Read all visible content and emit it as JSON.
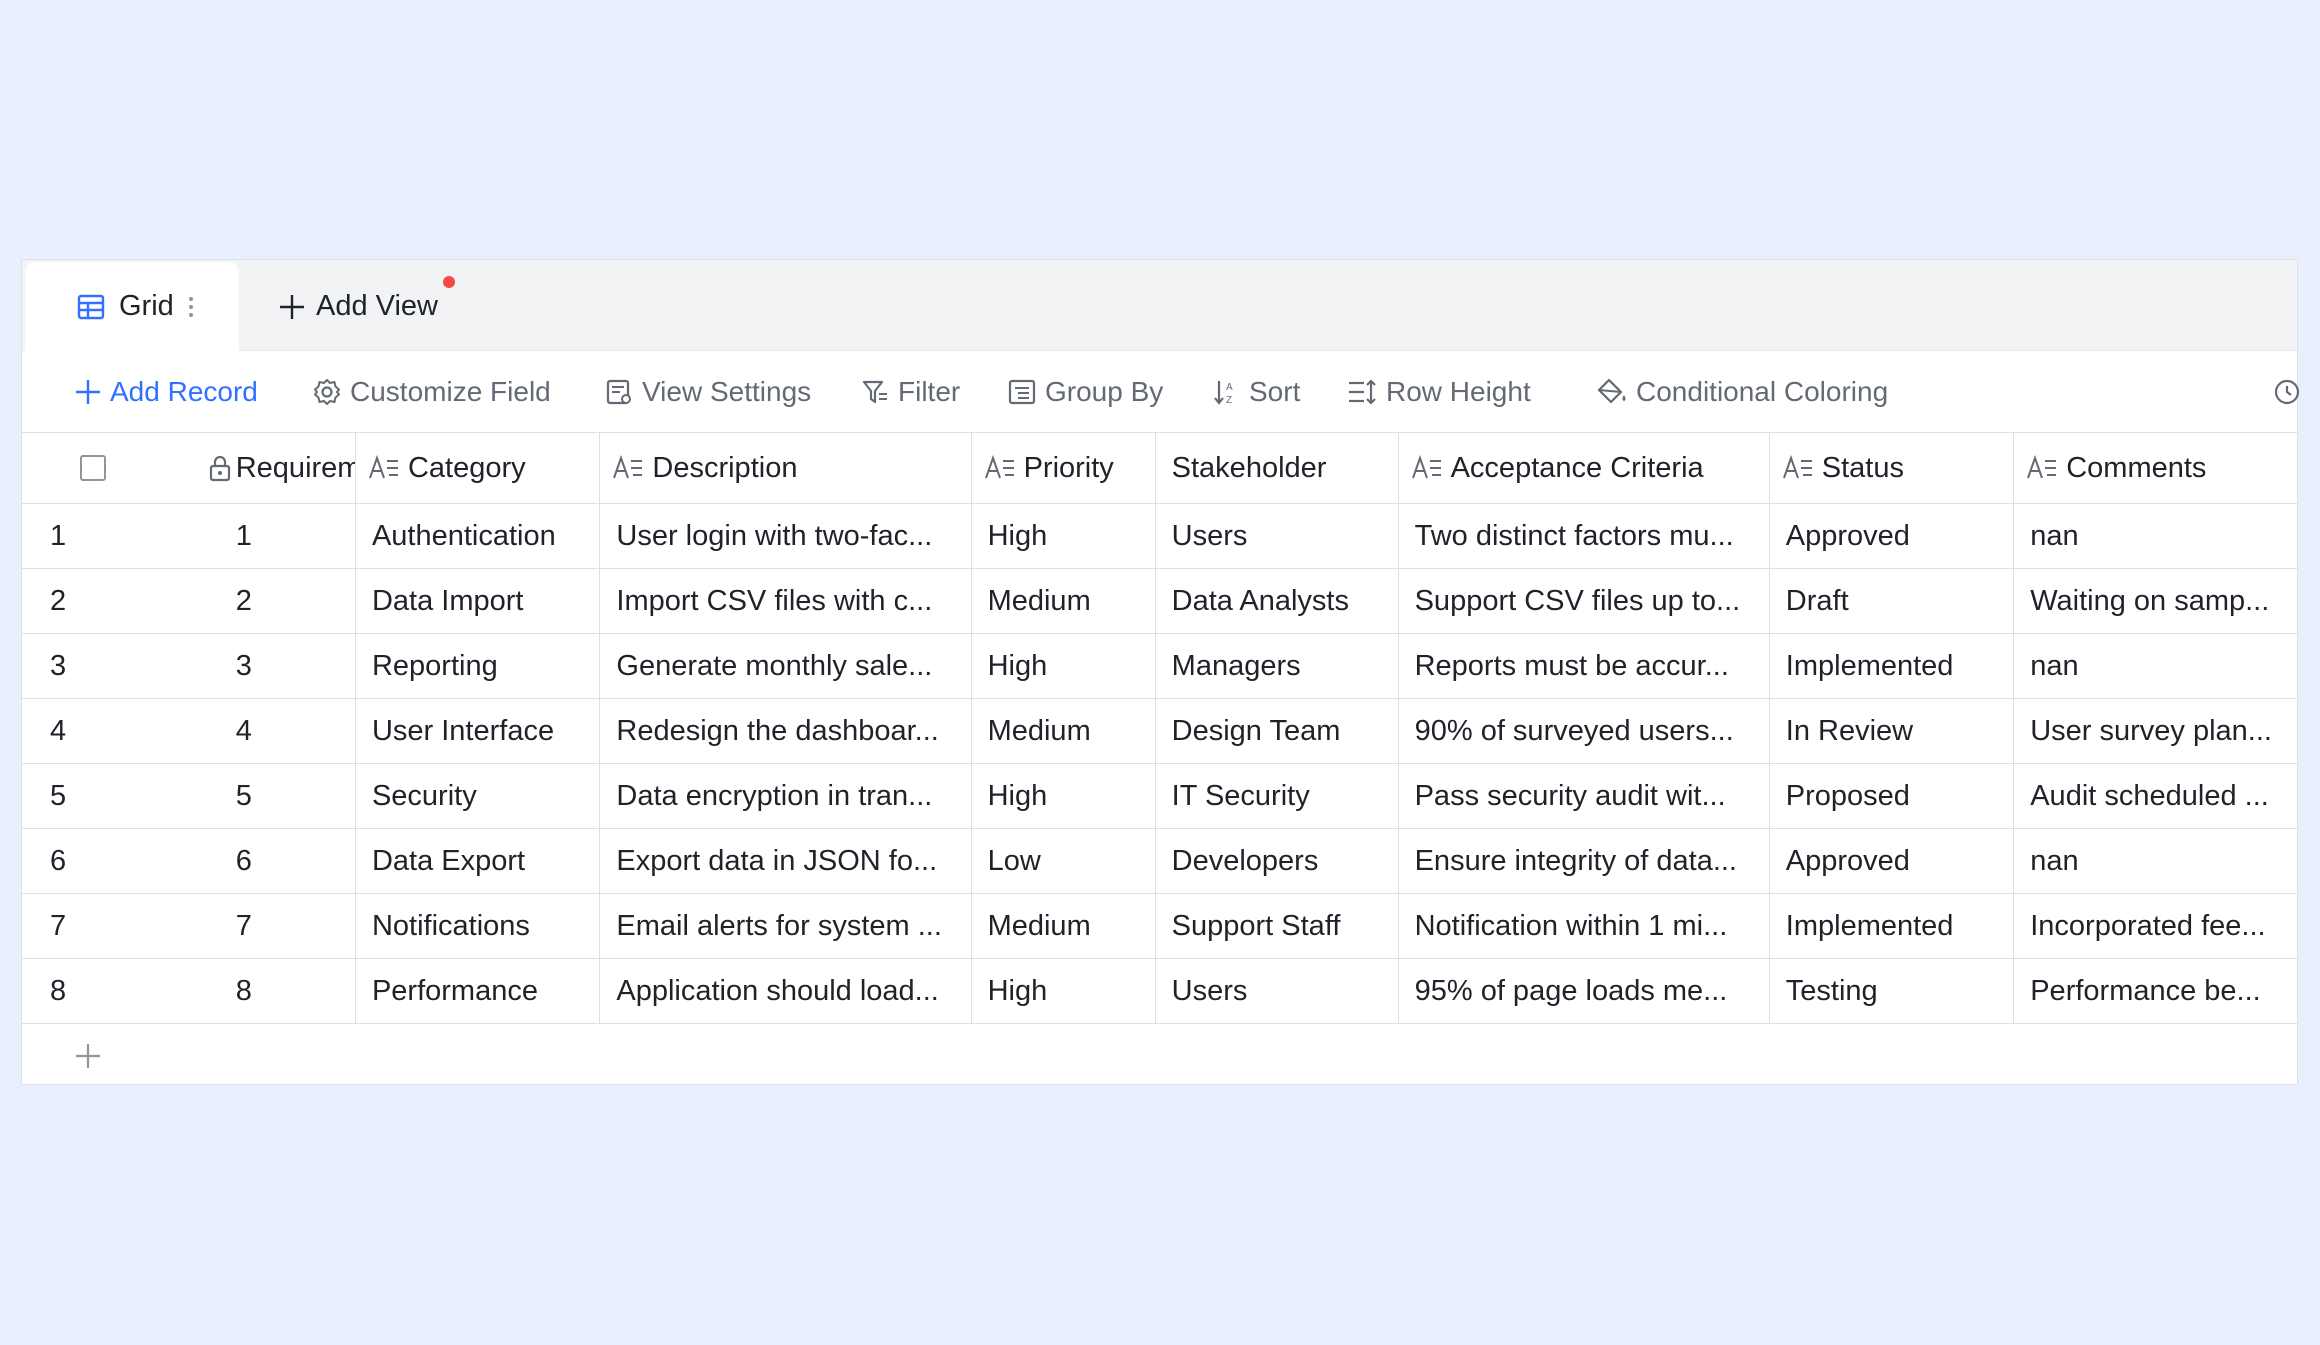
{
  "tabs": {
    "grid_label": "Grid",
    "add_view_label": "Add View"
  },
  "toolbar": {
    "add_record": "Add Record",
    "customize_field": "Customize Field",
    "view_settings": "View Settings",
    "filter": "Filter",
    "group_by": "Group By",
    "sort": "Sort",
    "row_height": "Row Height",
    "conditional_coloring": "Conditional Coloring"
  },
  "columns": {
    "requirement": "Requireme...",
    "category": "Category",
    "description": "Description",
    "priority": "Priority",
    "stakeholder": "Stakeholder",
    "acceptance": "Acceptance Criteria",
    "status": "Status",
    "comments": "Comments"
  },
  "rows": [
    {
      "idx": "1",
      "req": "1",
      "category": "Authentication",
      "description": "User login with two-fac...",
      "priority": "High",
      "stakeholder": "Users",
      "acceptance": "Two distinct factors mu...",
      "status": "Approved",
      "comments": "nan"
    },
    {
      "idx": "2",
      "req": "2",
      "category": "Data Import",
      "description": "Import CSV files with c...",
      "priority": "Medium",
      "stakeholder": "Data Analysts",
      "acceptance": "Support CSV files up to...",
      "status": "Draft",
      "comments": "Waiting on samp..."
    },
    {
      "idx": "3",
      "req": "3",
      "category": "Reporting",
      "description": "Generate monthly sale...",
      "priority": "High",
      "stakeholder": "Managers",
      "acceptance": "Reports must be accur...",
      "status": "Implemented",
      "comments": "nan"
    },
    {
      "idx": "4",
      "req": "4",
      "category": "User Interface",
      "description": "Redesign the dashboar...",
      "priority": "Medium",
      "stakeholder": "Design Team",
      "acceptance": "90% of surveyed users...",
      "status": "In Review",
      "comments": "User survey plan..."
    },
    {
      "idx": "5",
      "req": "5",
      "category": "Security",
      "description": "Data encryption in tran...",
      "priority": "High",
      "stakeholder": "IT Security",
      "acceptance": "Pass security audit wit...",
      "status": "Proposed",
      "comments": "Audit scheduled ..."
    },
    {
      "idx": "6",
      "req": "6",
      "category": "Data Export",
      "description": "Export data in JSON fo...",
      "priority": "Low",
      "stakeholder": "Developers",
      "acceptance": "Ensure integrity of data...",
      "status": "Approved",
      "comments": "nan"
    },
    {
      "idx": "7",
      "req": "7",
      "category": "Notifications",
      "description": "Email alerts for system ...",
      "priority": "Medium",
      "stakeholder": "Support Staff",
      "acceptance": "Notification within 1 mi...",
      "status": "Implemented",
      "comments": "Incorporated fee..."
    },
    {
      "idx": "8",
      "req": "8",
      "category": "Performance",
      "description": "Application should load...",
      "priority": "High",
      "stakeholder": "Users",
      "acceptance": "95% of page loads me...",
      "status": "Testing",
      "comments": "Performance be..."
    }
  ],
  "colors": {
    "accent": "#3370ff",
    "background": "#e9effd",
    "notification_dot": "#f54a45"
  }
}
